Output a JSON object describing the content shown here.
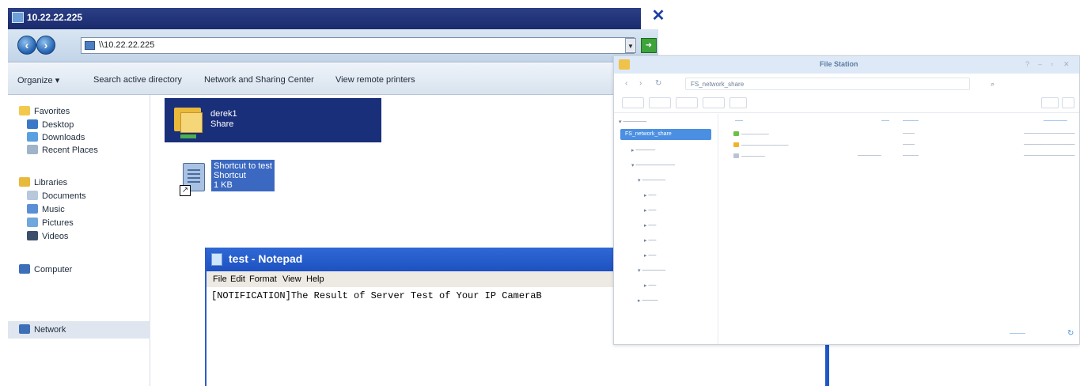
{
  "explorer": {
    "title": "10.22.22.225",
    "close_glyph": "✕",
    "address": "\\\\10.22.22.225",
    "commands": [
      "Organize ▾",
      "Search active directory",
      "Network and Sharing Center",
      "View remote printers"
    ],
    "nav": {
      "favorites": "Favorites",
      "desktop": "Desktop",
      "downloads": "Downloads",
      "recent": "Recent Places",
      "libraries": "Libraries",
      "documents": "Documents",
      "music": "Music",
      "pictures": "Pictures",
      "videos": "Videos",
      "computer": "Computer",
      "network": "Network"
    },
    "items": {
      "share_name": "derek1",
      "share_type": "Share",
      "shortcut_name": "Shortcut to test",
      "shortcut_type": "Shortcut",
      "shortcut_size": "1 KB"
    }
  },
  "notepad": {
    "title": "test - Notepad",
    "menu": [
      "File",
      "Edit",
      "Format",
      "View",
      "Help"
    ],
    "content": "[NOTIFICATION]The Result of Server Test of Your IP CameraB"
  },
  "filestation": {
    "title": "File Station",
    "path": "FS_network_share",
    "colors": {
      "accent": "#4b8fe2",
      "title_bg": "#dde9f7"
    },
    "selected_folder": "FS_network_share"
  }
}
